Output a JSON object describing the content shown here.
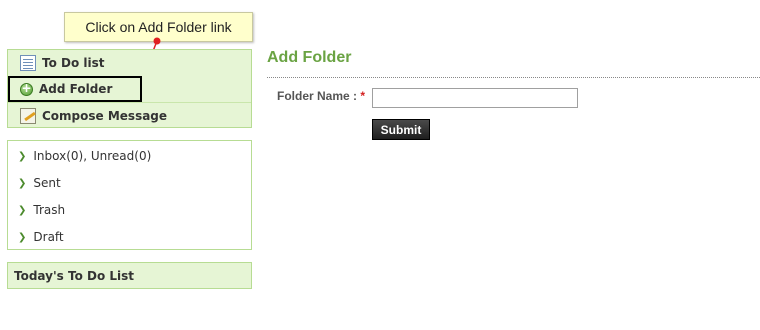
{
  "callout": {
    "text": "Click on Add Folder link"
  },
  "sidebar": {
    "menu": [
      {
        "label": "To Do list",
        "icon": "todo-list-icon"
      },
      {
        "label": "Add Folder",
        "icon": "add-circle-icon"
      },
      {
        "label": "Compose Message",
        "icon": "compose-icon"
      }
    ],
    "folders": [
      {
        "label": "Inbox(0), Unread(0)"
      },
      {
        "label": "Sent"
      },
      {
        "label": "Trash"
      },
      {
        "label": "Draft"
      }
    ],
    "todo_heading": "Today's To Do List"
  },
  "main": {
    "title": "Add Folder",
    "folder_name_label": "Folder Name :",
    "required_mark": "*",
    "folder_name_value": "",
    "submit_label": "Submit"
  },
  "colors": {
    "accent_green": "#6aa343",
    "sidebar_bg": "#e6f5d5",
    "sidebar_border": "#b7dc93",
    "callout_bg": "#ffffcc",
    "arrow_red": "#e02020"
  }
}
